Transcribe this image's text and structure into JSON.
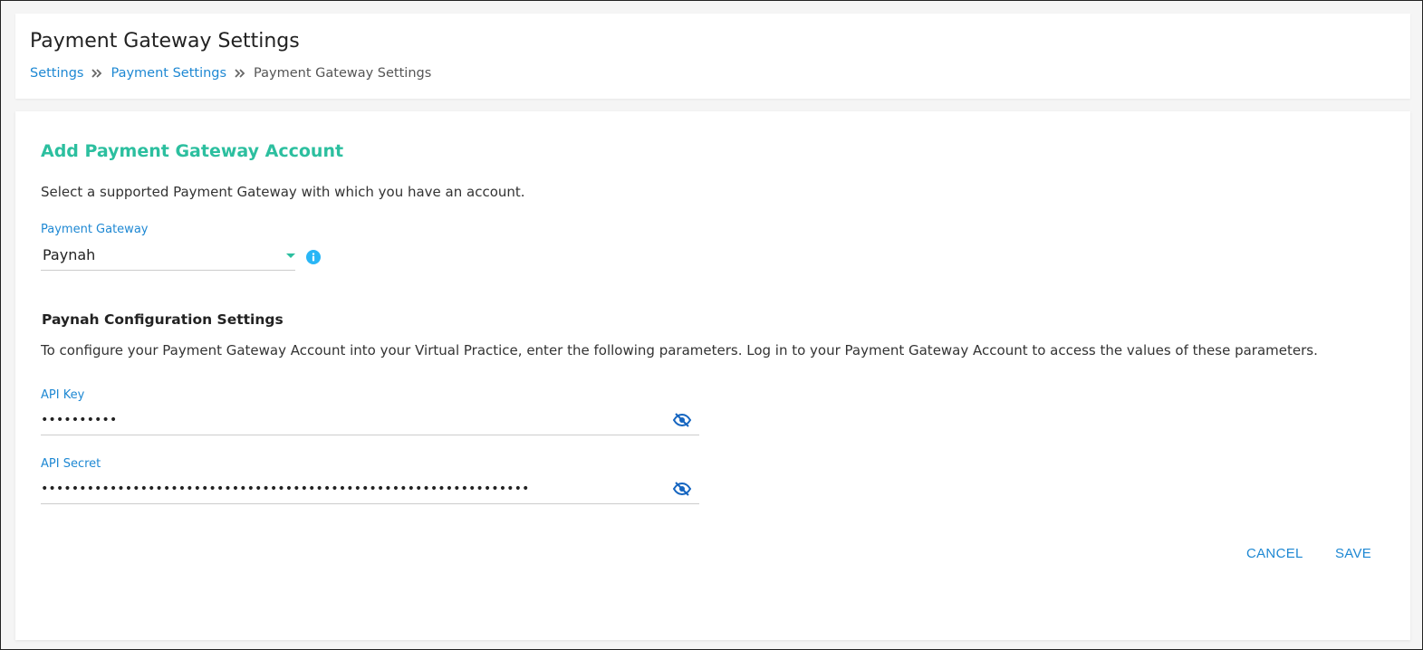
{
  "header": {
    "title": "Payment Gateway Settings",
    "breadcrumb": [
      {
        "label": "Settings"
      },
      {
        "label": "Payment Settings"
      },
      {
        "label": "Payment Gateway Settings"
      }
    ],
    "breadcrumb_separator_icon": "double-chevron-right-icon"
  },
  "form": {
    "section_title": "Add Payment Gateway Account",
    "intro": "Select a supported Payment Gateway with which you have an account.",
    "gateway": {
      "label": "Payment Gateway",
      "selected": "Paynah",
      "info_icon": "info-icon"
    },
    "config": {
      "title": "Paynah Configuration Settings",
      "description": "To configure your Payment Gateway Account into your Virtual Practice, enter the following parameters. Log in to your Payment Gateway Account to access the values of these parameters."
    },
    "api_key": {
      "label": "API Key",
      "masked_value": "••••••••••",
      "toggle_icon": "eye-slash-icon"
    },
    "api_secret": {
      "label": "API Secret",
      "masked_value": "••••••••••••••••••••••••••••••••••••••••••••••••••••••••••••••••",
      "toggle_icon": "eye-slash-icon"
    },
    "actions": {
      "cancel": "CANCEL",
      "save": "SAVE"
    }
  },
  "colors": {
    "accent_teal": "#2cbf9f",
    "link_blue": "#1e88d3",
    "info_blue": "#29b6f6",
    "icon_blue": "#1565c0"
  }
}
